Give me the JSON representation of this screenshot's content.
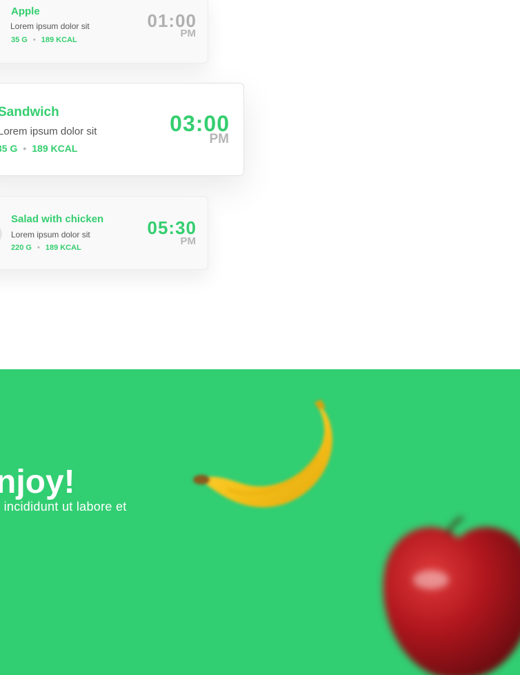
{
  "schedule": {
    "items": [
      {
        "name": "Apple",
        "description": "Lorem ipsum dolor sit",
        "weight": "35 G",
        "separator": "•",
        "calories": "189 KCAL",
        "time": "01:00",
        "period": "PM",
        "active": false
      },
      {
        "name": "Sandwich",
        "description": "Lorem ipsum dolor sit",
        "weight": "35 G",
        "separator": "•",
        "calories": "189 KCAL",
        "time": "03:00",
        "period": "PM",
        "active": true
      },
      {
        "name": "Salad with chicken",
        "description": "Lorem ipsum dolor sit",
        "weight": "220 G",
        "separator": "•",
        "calories": "189 KCAL",
        "time": "05:30",
        "period": "PM",
        "active": false
      }
    ]
  },
  "promo": {
    "headline": "njoy!",
    "subtext": "r incididunt ut labore et",
    "images": [
      "banana-image",
      "apple-image"
    ]
  },
  "colors": {
    "accent_green": "#32ce72",
    "time_inactive": "#b0b0b0",
    "time_active": "#34ce6f",
    "white": "#ffffff"
  }
}
